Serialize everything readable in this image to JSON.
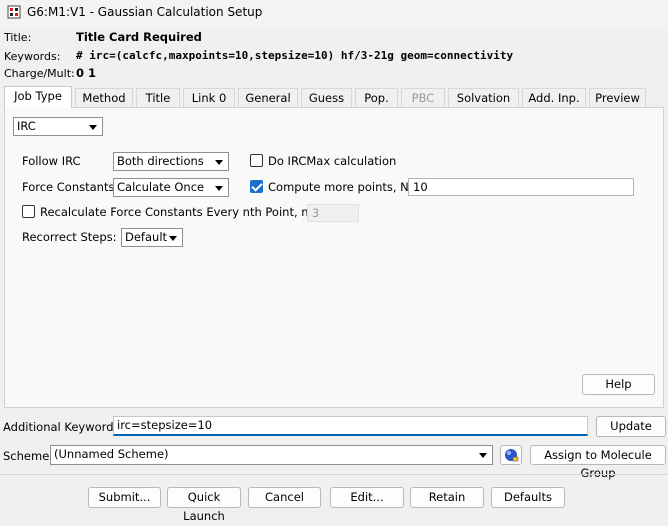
{
  "window": {
    "title": "G6:M1:V1 - Gaussian Calculation Setup"
  },
  "header": {
    "title_label": "Title:",
    "title_value": "Title Card Required",
    "keywords_label": "Keywords:",
    "keywords_value": "# irc=(calcfc,maxpoints=10,stepsize=10) hf/3-21g geom=connectivity",
    "charge_label": "Charge/Mult:",
    "charge_value": "0 1"
  },
  "tabs": [
    {
      "label": "Job Type",
      "active": true
    },
    {
      "label": "Method"
    },
    {
      "label": "Title"
    },
    {
      "label": "Link 0"
    },
    {
      "label": "General"
    },
    {
      "label": "Guess"
    },
    {
      "label": "Pop."
    },
    {
      "label": "PBC",
      "disabled": true
    },
    {
      "label": "Solvation"
    },
    {
      "label": "Add. Inp."
    },
    {
      "label": "Preview"
    }
  ],
  "job": {
    "job_type": "IRC",
    "follow_label": "Follow IRC",
    "follow_value": "Both directions",
    "force_label": "Force Constants",
    "force_value": "Calculate Once",
    "ircmax_label": "Do IRCMax calculation",
    "ircmax_checked": false,
    "compute_label": "Compute more points, N=",
    "compute_checked": true,
    "compute_value": "10",
    "recalc_label": "Recalculate Force Constants Every nth Point, n =",
    "recalc_checked": false,
    "recalc_value": "3",
    "recorrect_label": "Recorrect Steps:",
    "recorrect_value": "Default",
    "help_label": "Help"
  },
  "additional": {
    "label": "Additional Keywords:",
    "value": "irc=stepsize=10",
    "update_label": "Update"
  },
  "scheme": {
    "label": "Scheme:",
    "value": "(Unnamed Scheme)",
    "assign_label": "Assign to Molecule Group"
  },
  "footer": {
    "submit": "Submit...",
    "quick": "Quick Launch",
    "cancel": "Cancel",
    "edit": "Edit...",
    "retain": "Retain",
    "defaults": "Defaults"
  },
  "colors": {
    "accent": "#1a6fc9",
    "input_focus": "#0063b1"
  }
}
